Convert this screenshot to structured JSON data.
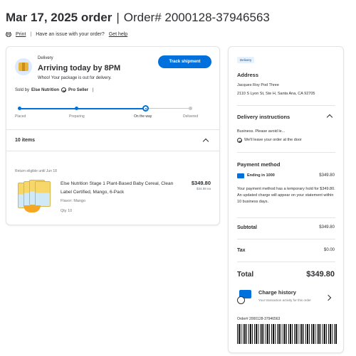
{
  "header": {
    "date_order": "Mar 17, 2025 order",
    "separator": "|",
    "order_number": "Order# 2000128-37946563"
  },
  "subnav": {
    "print_label": "Print",
    "separator": "|",
    "issue_text": "Have an issue with your order?",
    "help_link": "Get help"
  },
  "delivery": {
    "label": "Delivery",
    "title": "Arriving today by 8PM",
    "message": "Whoo! Your package is out for delivery.",
    "track_button": "Track shipment",
    "sold_by_prefix": "Sold by",
    "seller": "Else Nutrition",
    "pro_seller": "Pro Seller",
    "sold_by_sep": "|"
  },
  "progress": {
    "fraction_complete": 0.75,
    "steps": [
      {
        "label": "Placed"
      },
      {
        "label": "Preparing"
      },
      {
        "label": "On the way"
      },
      {
        "label": "Delivered"
      }
    ],
    "current_step": 2
  },
  "items": {
    "count_label": "10 items",
    "return_text": "Return eligible until Jun 18",
    "product": {
      "name": "Else Nutrition Stage 1 Plant-Based Baby Cereal, Clean Label Certified, Mango, 6-Pack",
      "flavor": "Flavor: Mango",
      "qty": "Qty 10",
      "price": "$349.80",
      "each": "$34.98 ea"
    }
  },
  "sidebar": {
    "badge": "Delivery",
    "address_heading": "Address",
    "address_name": "Jacques Roy Pod Three",
    "address_line": "2110 S Lyon St, Ste H, Santa Ana, CA 92705",
    "instructions_heading": "Delivery instructions",
    "instructions_text": "Business. Please avoid le...",
    "leave_at_door": "We'll leave your order at the door",
    "payment_heading": "Payment method",
    "card_ending": "Ending in 1000",
    "card_amount": "$349.80",
    "payment_note": "Your payment method has a temporary hold for $349.80. An updated charge will appear on your statement within 10 business days.",
    "subtotal_label": "Subtotal",
    "subtotal_value": "$349.80",
    "tax_label": "Tax",
    "tax_value": "$0.00",
    "total_label": "Total",
    "total_value": "$349.80",
    "charge_history_title": "Charge history",
    "charge_history_sub": "Your transaction activity for this order",
    "order_barcode_label": "Order# 2000128-37946563"
  },
  "colors": {
    "accent": "#0071dc",
    "text": "#2e2f32",
    "muted": "#74767c",
    "border": "#e3e4e5"
  }
}
